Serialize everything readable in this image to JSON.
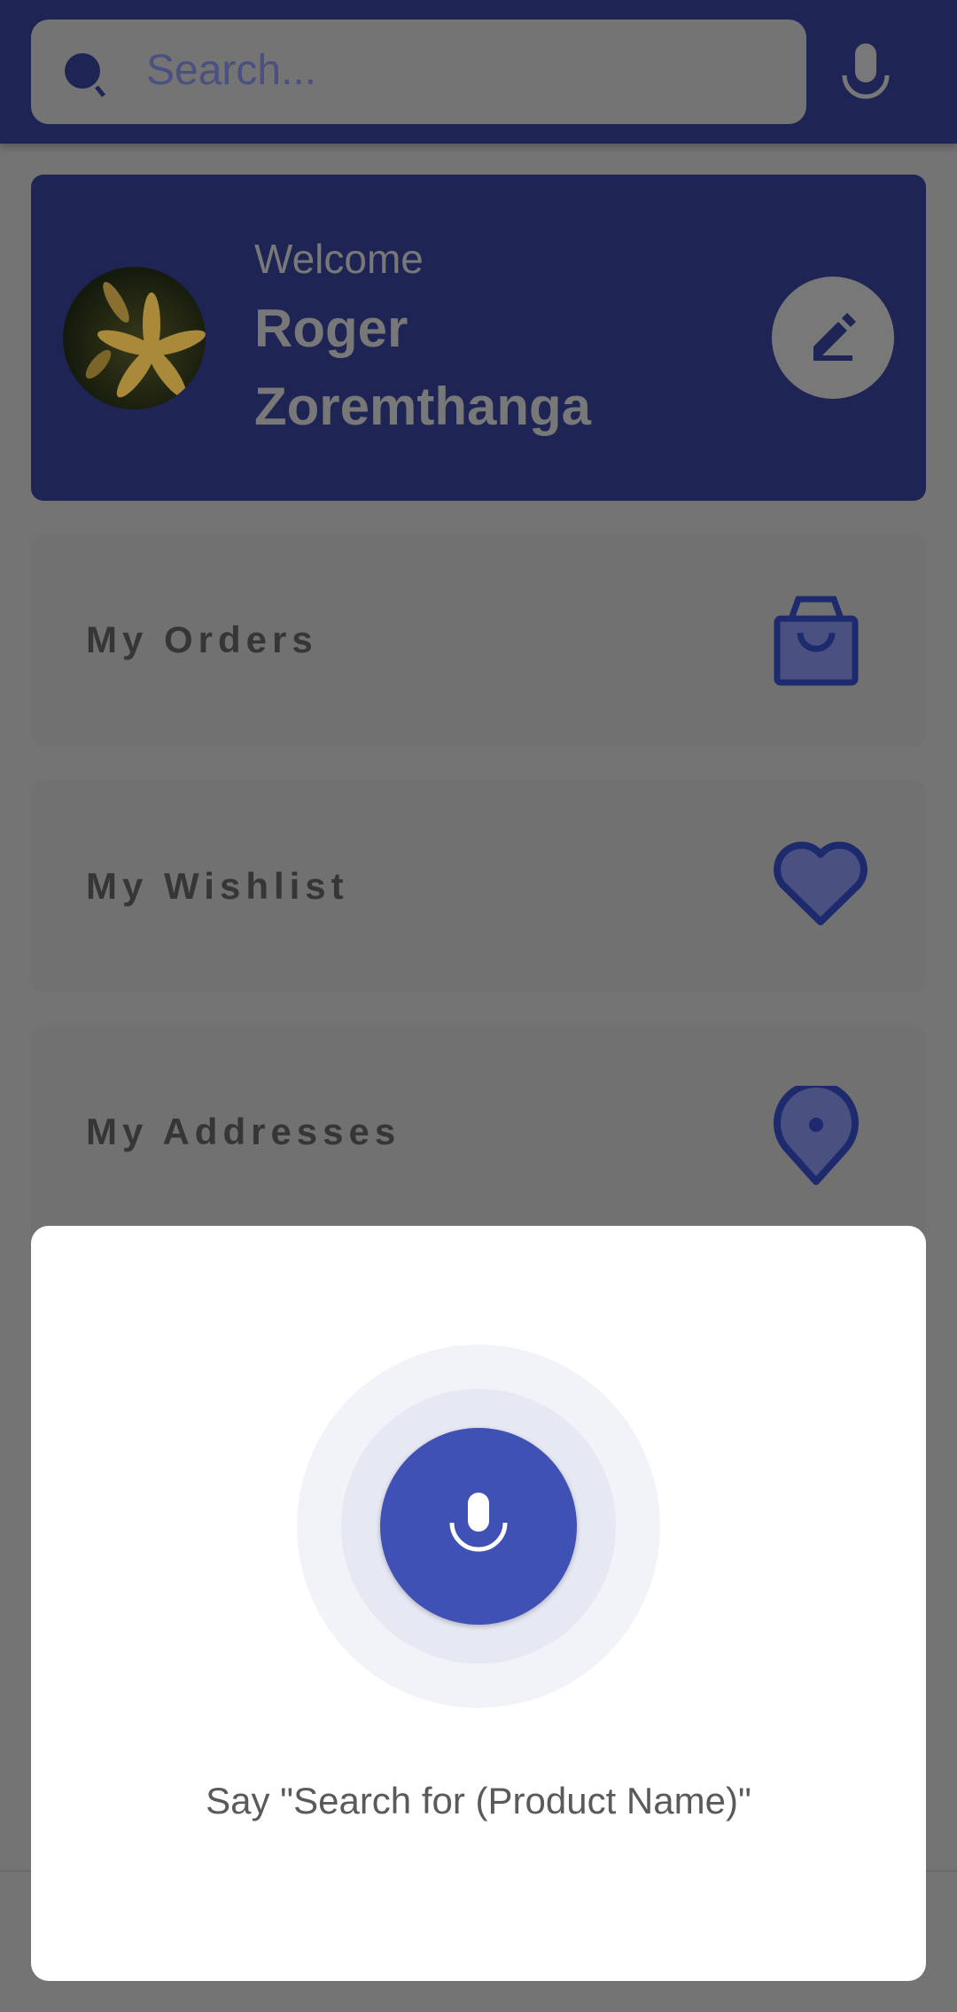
{
  "search": {
    "placeholder": "Search..."
  },
  "profile": {
    "welcome": "Welcome",
    "name": "Roger Zoremthanga"
  },
  "menu": [
    {
      "label": "My Orders",
      "icon": "shopping-bag-icon"
    },
    {
      "label": "My Wishlist",
      "icon": "heart-icon"
    },
    {
      "label": "My Addresses",
      "icon": "location-pin-icon"
    }
  ],
  "voice_dialog": {
    "hint": "Say \"Search for (Product Name)\""
  },
  "colors": {
    "accent": "#3f51b5",
    "header": "#1e2454"
  }
}
